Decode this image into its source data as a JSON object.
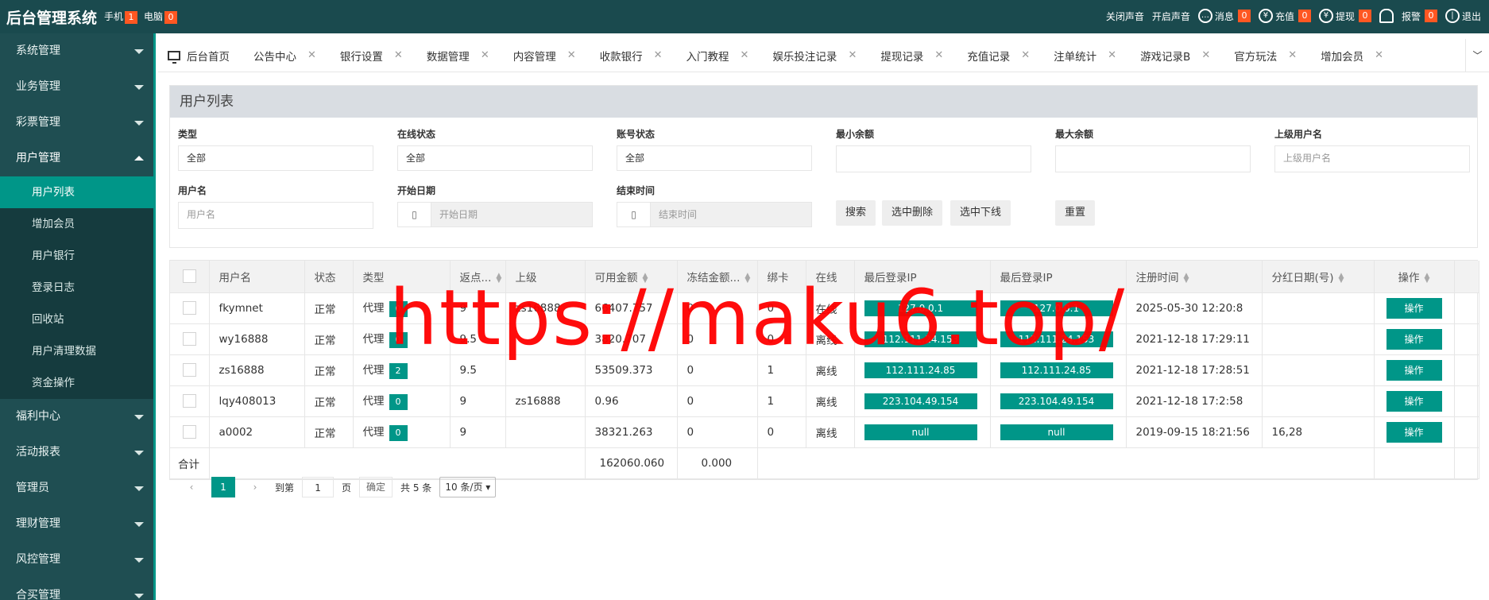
{
  "topbar": {
    "brand": "后台管理系统",
    "phone_label": "手机",
    "phone_count": "1",
    "pc_label": "电脑",
    "pc_count": "0",
    "right": {
      "sound_off": "关闭声音",
      "sound_on": "开启声音",
      "message_label": "消息",
      "message_count": "0",
      "recharge_label": "充值",
      "recharge_count": "0",
      "withdraw_label": "提现",
      "withdraw_count": "0",
      "alarm_label": "报警",
      "alarm_count": "0",
      "logout_label": "退出"
    }
  },
  "sidebar": {
    "items": [
      {
        "label": "系统管理"
      },
      {
        "label": "业务管理"
      },
      {
        "label": "彩票管理"
      },
      {
        "label": "用户管理"
      },
      {
        "label": "福利中心"
      },
      {
        "label": "活动报表"
      },
      {
        "label": "管理员"
      },
      {
        "label": "理财管理"
      },
      {
        "label": "风控管理"
      },
      {
        "label": "合买管理"
      }
    ],
    "submenu": [
      {
        "label": "用户列表"
      },
      {
        "label": "增加会员"
      },
      {
        "label": "用户银行"
      },
      {
        "label": "登录日志"
      },
      {
        "label": "回收站"
      },
      {
        "label": "用户清理数据"
      },
      {
        "label": "资金操作"
      }
    ]
  },
  "tabs": [
    {
      "label": "后台首页"
    },
    {
      "label": "公告中心"
    },
    {
      "label": "银行设置"
    },
    {
      "label": "数据管理"
    },
    {
      "label": "内容管理"
    },
    {
      "label": "收款银行"
    },
    {
      "label": "入门教程"
    },
    {
      "label": "娱乐投注记录"
    },
    {
      "label": "提现记录"
    },
    {
      "label": "充值记录"
    },
    {
      "label": "注单统计"
    },
    {
      "label": "游戏记录B"
    },
    {
      "label": "官方玩法"
    },
    {
      "label": "增加会员"
    }
  ],
  "filter": {
    "title": "用户列表",
    "type_label": "类型",
    "type_value": "全部",
    "online_label": "在线状态",
    "online_value": "全部",
    "account_label": "账号状态",
    "account_value": "全部",
    "min_label": "最小余额",
    "max_label": "最大余额",
    "parent_label": "上级用户名",
    "parent_placeholder": "上级用户名",
    "username_label": "用户名",
    "username_placeholder": "用户名",
    "start_label": "开始日期",
    "start_placeholder": "开始日期",
    "end_label": "结束时间",
    "end_placeholder": "结束时间",
    "search_btn": "搜索",
    "delete_btn": "选中删除",
    "offline_btn": "选中下线",
    "reset_btn": "重置"
  },
  "table": {
    "headers": {
      "username": "用户名",
      "status": "状态",
      "type": "类型",
      "rebate": "返点...",
      "parent": "上级",
      "balance": "可用金额",
      "frozen": "冻结金额...",
      "bindcard": "绑卡",
      "online": "在线",
      "last_ip1": "最后登录IP",
      "last_ip2": "最后登录IP",
      "reg_time": "注册时间",
      "dividend": "分红日期(号)",
      "action": "操作"
    },
    "rows": [
      {
        "username": "fkymnet",
        "status": "正常",
        "type": "代理",
        "tag": "0",
        "rebate": "9",
        "parent": "zs16888",
        "balance": "66407.757",
        "frozen": "0",
        "bindcard": "0",
        "online": "在线",
        "ip1": "127.0.0.1",
        "ip2": "127.0.0.1",
        "reg": "2025-05-30 12:20:8",
        "dividend": "",
        "op": "操作"
      },
      {
        "username": "wy16888",
        "status": "正常",
        "type": "代理",
        "tag": "0",
        "rebate": "9.5",
        "parent": "",
        "balance": "3820.707",
        "frozen": "0",
        "bindcard": "0",
        "online": "离线",
        "ip1": "112.111.24.153",
        "ip2": "112.111.24.153",
        "reg": "2021-12-18 17:29:11",
        "dividend": "",
        "op": "操作"
      },
      {
        "username": "zs16888",
        "status": "正常",
        "type": "代理",
        "tag": "2",
        "rebate": "9.5",
        "parent": "",
        "balance": "53509.373",
        "frozen": "0",
        "bindcard": "1",
        "online": "离线",
        "ip1": "112.111.24.85",
        "ip2": "112.111.24.85",
        "reg": "2021-12-18 17:28:51",
        "dividend": "",
        "op": "操作"
      },
      {
        "username": "lqy408013",
        "status": "正常",
        "type": "代理",
        "tag": "0",
        "rebate": "9",
        "parent": "zs16888",
        "balance": "0.96",
        "frozen": "0",
        "bindcard": "1",
        "online": "离线",
        "ip1": "223.104.49.154",
        "ip2": "223.104.49.154",
        "reg": "2021-12-18 17:2:58",
        "dividend": "",
        "op": "操作"
      },
      {
        "username": "a0002",
        "status": "正常",
        "type": "代理",
        "tag": "0",
        "rebate": "9",
        "parent": "",
        "balance": "38321.263",
        "frozen": "0",
        "bindcard": "0",
        "online": "离线",
        "ip1": "null",
        "ip2": "null",
        "reg": "2019-09-15 18:21:56",
        "dividend": "16,28",
        "op": "操作"
      }
    ],
    "total_label": "合计",
    "total_balance": "162060.060",
    "total_frozen": "0.000"
  },
  "pager": {
    "current": "1",
    "goto_label": "到第",
    "goto_value": "1",
    "page_unit": "页",
    "confirm": "确定",
    "total": "共 5 条",
    "per_page": "10 条/页"
  },
  "watermark": "https://maku6.top/",
  "colors": {
    "accent": "#009688",
    "topbar": "#1a4a4e",
    "sidebar": "#1f4e52",
    "badge": "#ff5722"
  }
}
